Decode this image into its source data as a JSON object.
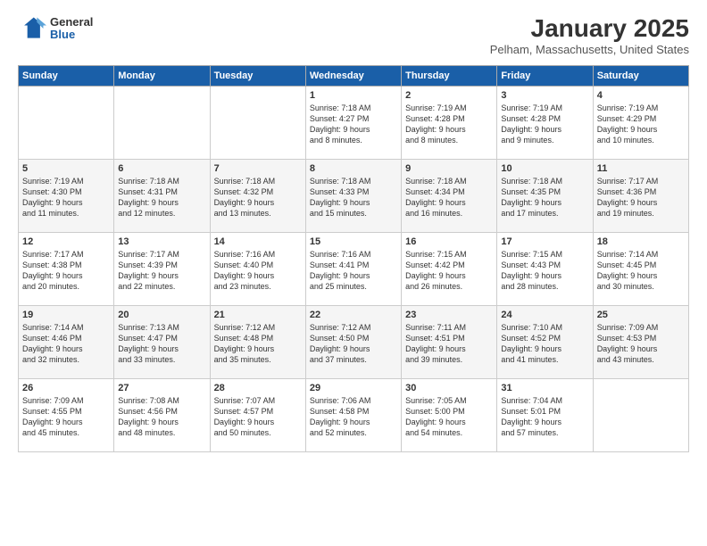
{
  "logo": {
    "general": "General",
    "blue": "Blue"
  },
  "title": "January 2025",
  "location": "Pelham, Massachusetts, United States",
  "days_header": [
    "Sunday",
    "Monday",
    "Tuesday",
    "Wednesday",
    "Thursday",
    "Friday",
    "Saturday"
  ],
  "weeks": [
    [
      {
        "day": "",
        "content": ""
      },
      {
        "day": "",
        "content": ""
      },
      {
        "day": "",
        "content": ""
      },
      {
        "day": "1",
        "content": "Sunrise: 7:18 AM\nSunset: 4:27 PM\nDaylight: 9 hours\nand 8 minutes."
      },
      {
        "day": "2",
        "content": "Sunrise: 7:19 AM\nSunset: 4:28 PM\nDaylight: 9 hours\nand 8 minutes."
      },
      {
        "day": "3",
        "content": "Sunrise: 7:19 AM\nSunset: 4:28 PM\nDaylight: 9 hours\nand 9 minutes."
      },
      {
        "day": "4",
        "content": "Sunrise: 7:19 AM\nSunset: 4:29 PM\nDaylight: 9 hours\nand 10 minutes."
      }
    ],
    [
      {
        "day": "5",
        "content": "Sunrise: 7:19 AM\nSunset: 4:30 PM\nDaylight: 9 hours\nand 11 minutes."
      },
      {
        "day": "6",
        "content": "Sunrise: 7:18 AM\nSunset: 4:31 PM\nDaylight: 9 hours\nand 12 minutes."
      },
      {
        "day": "7",
        "content": "Sunrise: 7:18 AM\nSunset: 4:32 PM\nDaylight: 9 hours\nand 13 minutes."
      },
      {
        "day": "8",
        "content": "Sunrise: 7:18 AM\nSunset: 4:33 PM\nDaylight: 9 hours\nand 15 minutes."
      },
      {
        "day": "9",
        "content": "Sunrise: 7:18 AM\nSunset: 4:34 PM\nDaylight: 9 hours\nand 16 minutes."
      },
      {
        "day": "10",
        "content": "Sunrise: 7:18 AM\nSunset: 4:35 PM\nDaylight: 9 hours\nand 17 minutes."
      },
      {
        "day": "11",
        "content": "Sunrise: 7:17 AM\nSunset: 4:36 PM\nDaylight: 9 hours\nand 19 minutes."
      }
    ],
    [
      {
        "day": "12",
        "content": "Sunrise: 7:17 AM\nSunset: 4:38 PM\nDaylight: 9 hours\nand 20 minutes."
      },
      {
        "day": "13",
        "content": "Sunrise: 7:17 AM\nSunset: 4:39 PM\nDaylight: 9 hours\nand 22 minutes."
      },
      {
        "day": "14",
        "content": "Sunrise: 7:16 AM\nSunset: 4:40 PM\nDaylight: 9 hours\nand 23 minutes."
      },
      {
        "day": "15",
        "content": "Sunrise: 7:16 AM\nSunset: 4:41 PM\nDaylight: 9 hours\nand 25 minutes."
      },
      {
        "day": "16",
        "content": "Sunrise: 7:15 AM\nSunset: 4:42 PM\nDaylight: 9 hours\nand 26 minutes."
      },
      {
        "day": "17",
        "content": "Sunrise: 7:15 AM\nSunset: 4:43 PM\nDaylight: 9 hours\nand 28 minutes."
      },
      {
        "day": "18",
        "content": "Sunrise: 7:14 AM\nSunset: 4:45 PM\nDaylight: 9 hours\nand 30 minutes."
      }
    ],
    [
      {
        "day": "19",
        "content": "Sunrise: 7:14 AM\nSunset: 4:46 PM\nDaylight: 9 hours\nand 32 minutes."
      },
      {
        "day": "20",
        "content": "Sunrise: 7:13 AM\nSunset: 4:47 PM\nDaylight: 9 hours\nand 33 minutes."
      },
      {
        "day": "21",
        "content": "Sunrise: 7:12 AM\nSunset: 4:48 PM\nDaylight: 9 hours\nand 35 minutes."
      },
      {
        "day": "22",
        "content": "Sunrise: 7:12 AM\nSunset: 4:50 PM\nDaylight: 9 hours\nand 37 minutes."
      },
      {
        "day": "23",
        "content": "Sunrise: 7:11 AM\nSunset: 4:51 PM\nDaylight: 9 hours\nand 39 minutes."
      },
      {
        "day": "24",
        "content": "Sunrise: 7:10 AM\nSunset: 4:52 PM\nDaylight: 9 hours\nand 41 minutes."
      },
      {
        "day": "25",
        "content": "Sunrise: 7:09 AM\nSunset: 4:53 PM\nDaylight: 9 hours\nand 43 minutes."
      }
    ],
    [
      {
        "day": "26",
        "content": "Sunrise: 7:09 AM\nSunset: 4:55 PM\nDaylight: 9 hours\nand 45 minutes."
      },
      {
        "day": "27",
        "content": "Sunrise: 7:08 AM\nSunset: 4:56 PM\nDaylight: 9 hours\nand 48 minutes."
      },
      {
        "day": "28",
        "content": "Sunrise: 7:07 AM\nSunset: 4:57 PM\nDaylight: 9 hours\nand 50 minutes."
      },
      {
        "day": "29",
        "content": "Sunrise: 7:06 AM\nSunset: 4:58 PM\nDaylight: 9 hours\nand 52 minutes."
      },
      {
        "day": "30",
        "content": "Sunrise: 7:05 AM\nSunset: 5:00 PM\nDaylight: 9 hours\nand 54 minutes."
      },
      {
        "day": "31",
        "content": "Sunrise: 7:04 AM\nSunset: 5:01 PM\nDaylight: 9 hours\nand 57 minutes."
      },
      {
        "day": "",
        "content": ""
      }
    ]
  ]
}
